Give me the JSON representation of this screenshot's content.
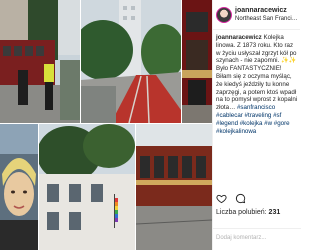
{
  "post": {
    "username": "joannaracewicz",
    "location": "Northeast San Franci…",
    "caption_user": "joannaracewicz",
    "caption_body": "Kolejka linowa. Z 1873 roku. Kto raz w życiu usłyszał zgrzyt kół po szynach - nie zapomni. ✨✨ Było FANTASTYCZNIE! Biłam się z oczyma myśląc, że kiedyś jeździły tu konne zaprzęgi, a potem ktoś wpadł na to pomysł wprost z kopalni złota… ",
    "caption_hashtags": "#sanfrancisco #cablecar #traveling #sf #legend #kolejka #w #gore #kolejkalinowa"
  },
  "actions": {
    "like_icon": "heart-outline-icon",
    "comment_icon": "speech-bubble-icon"
  },
  "likes": {
    "label": "Liczba polubień:",
    "count": "231"
  },
  "comment": {
    "placeholder": "Dodaj komentarz..."
  },
  "colors": {
    "link": "#003569",
    "text": "#262626",
    "border": "#efefef",
    "tram_red": "#8e1b1b",
    "street_red": "#b8342c"
  }
}
